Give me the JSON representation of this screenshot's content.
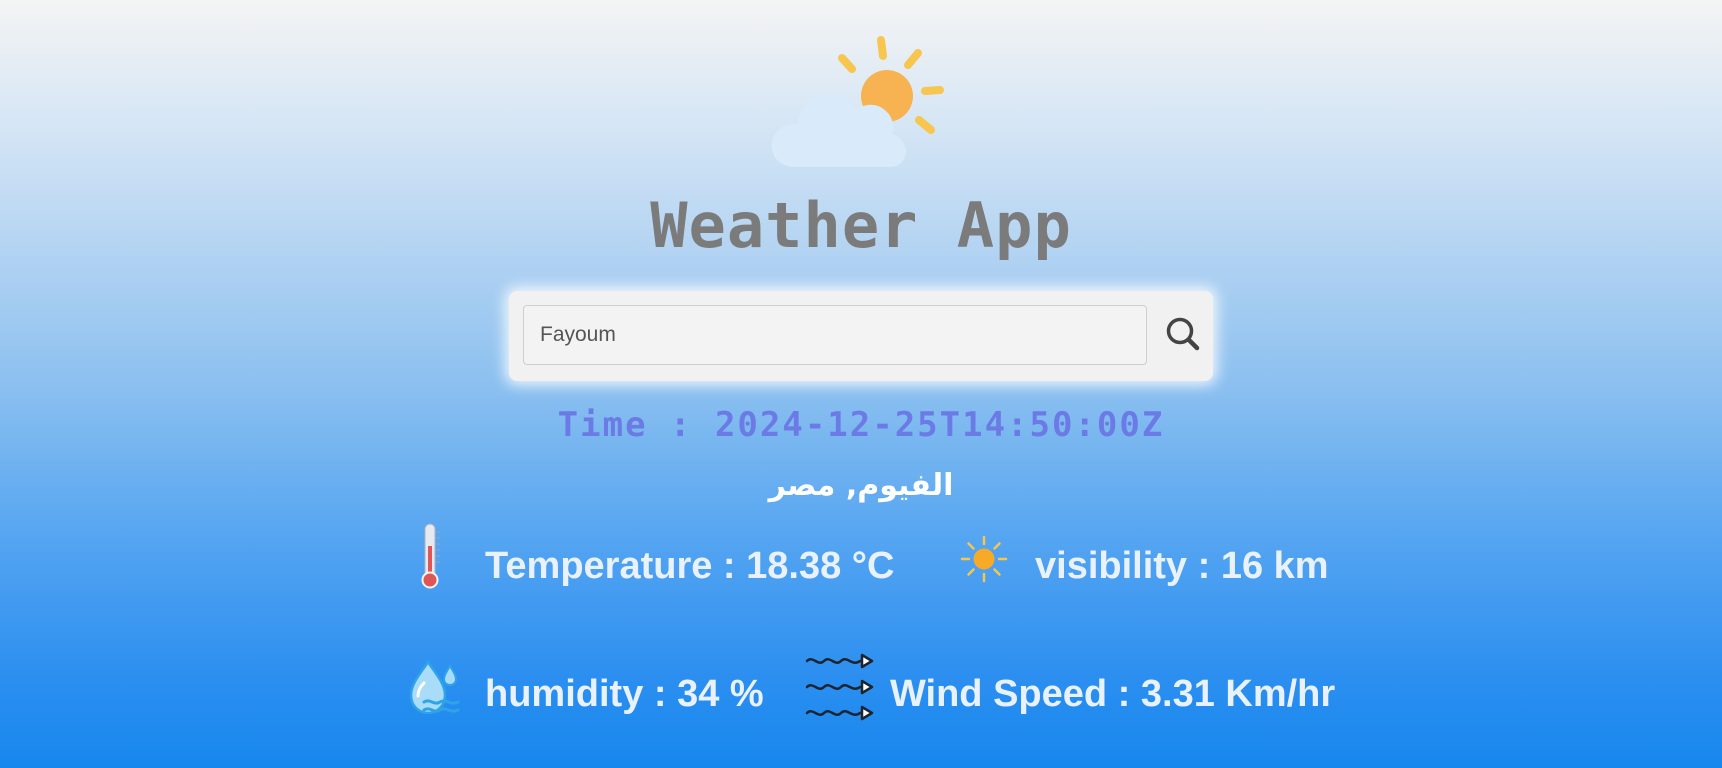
{
  "app": {
    "title": "Weather App",
    "logo_icon": "sun-behind-cloud-icon"
  },
  "search": {
    "value": "Fayoum",
    "placeholder": "Fayoum",
    "button_icon": "search-icon"
  },
  "time": {
    "text": "Time : 2024-12-25T14:50:00Z"
  },
  "location": {
    "text": "الفيوم, مصر"
  },
  "stats": {
    "temperature": {
      "label": "Temperature : 18.38 °C",
      "icon": "thermometer-icon"
    },
    "visibility": {
      "label": "visibility : 16 km",
      "icon": "sun-icon"
    },
    "humidity": {
      "label": "humidity : 34 %",
      "icon": "water-drop-icon"
    },
    "wind_speed": {
      "label": "Wind Speed : 3.31 Km/hr",
      "icon": "wind-icon"
    }
  },
  "colors": {
    "title": "#7b7b7b",
    "time": "#6c7ae6",
    "stat_text": "#e9f1fb",
    "background_top": "#f4f4f4",
    "background_bottom": "#1787ee"
  }
}
